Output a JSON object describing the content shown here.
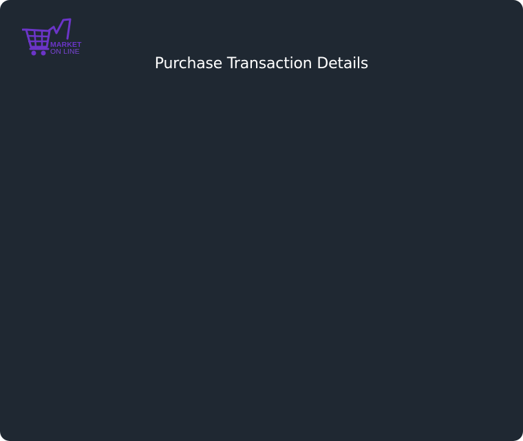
{
  "brand": {
    "line1": "MARKET",
    "line2": "ON LINE",
    "color": "#6b35c8"
  },
  "dialog": {
    "title": "Purchase Transaction Details",
    "background": "#1f2832"
  }
}
